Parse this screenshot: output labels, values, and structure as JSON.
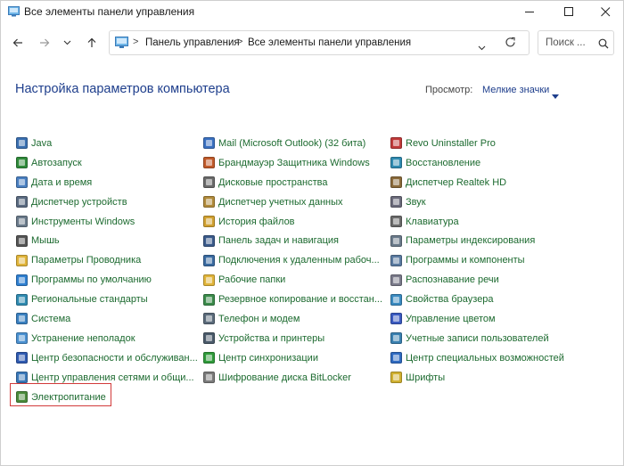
{
  "window": {
    "title": "Все элементы панели управления"
  },
  "address": {
    "crumbs": [
      "Панель управления",
      "Все элементы панели управления"
    ],
    "separator": ">"
  },
  "search": {
    "placeholder": "Поиск ..."
  },
  "header": {
    "title": "Настройка параметров компьютера",
    "view_label": "Просмотр:",
    "view_value": "Мелкие значки"
  },
  "items": {
    "col1": [
      {
        "label": "Java",
        "icon": "java-icon",
        "color": "#3a6fb0"
      },
      {
        "label": "Автозапуск",
        "icon": "autoplay-icon",
        "color": "#2f8a3a"
      },
      {
        "label": "Дата и время",
        "icon": "clock-icon",
        "color": "#4a7fc0"
      },
      {
        "label": "Диспетчер устройств",
        "icon": "device-manager-icon",
        "color": "#5a6a80"
      },
      {
        "label": "Инструменты Windows",
        "icon": "tools-icon",
        "color": "#6a7a8a"
      },
      {
        "label": "Мышь",
        "icon": "mouse-icon",
        "color": "#555555"
      },
      {
        "label": "Параметры Проводника",
        "icon": "folder-options-icon",
        "color": "#e0b43a"
      },
      {
        "label": "Программы по умолчанию",
        "icon": "default-programs-icon",
        "color": "#2f7fd0"
      },
      {
        "label": "Региональные стандарты",
        "icon": "region-icon",
        "color": "#2f8ab0"
      },
      {
        "label": "Система",
        "icon": "system-icon",
        "color": "#3a80c0"
      },
      {
        "label": "Устранение неполадок",
        "icon": "troubleshoot-icon",
        "color": "#4a90d0"
      },
      {
        "label": "Центр безопасности и обслуживан...",
        "icon": "security-flag-icon",
        "color": "#2f5ab0"
      },
      {
        "label": "Центр управления сетями и общи...",
        "icon": "network-icon",
        "color": "#3a78b8"
      },
      {
        "label": "Электропитание",
        "icon": "power-icon",
        "color": "#4a8a3a"
      }
    ],
    "col2": [
      {
        "label": "Mail (Microsoft Outlook) (32 бита)",
        "icon": "mail-icon",
        "color": "#3a70c0"
      },
      {
        "label": "Брандмауэр Защитника Windows",
        "icon": "firewall-icon",
        "color": "#c05a2a"
      },
      {
        "label": "Дисковые пространства",
        "icon": "storage-spaces-icon",
        "color": "#6a6a6a"
      },
      {
        "label": "Диспетчер учетных данных",
        "icon": "credentials-icon",
        "color": "#b08a3a"
      },
      {
        "label": "История файлов",
        "icon": "file-history-icon",
        "color": "#d0a030"
      },
      {
        "label": "Панель задач и навигация",
        "icon": "taskbar-icon",
        "color": "#3a5a8a"
      },
      {
        "label": "Подключения к удаленным рабоч...",
        "icon": "remote-desktop-icon",
        "color": "#3a6aa0"
      },
      {
        "label": "Рабочие папки",
        "icon": "work-folders-icon",
        "color": "#e0b43a"
      },
      {
        "label": "Резервное копирование и восстан...",
        "icon": "backup-icon",
        "color": "#3a8a4a"
      },
      {
        "label": "Телефон и модем",
        "icon": "phone-icon",
        "color": "#5a6a7a"
      },
      {
        "label": "Устройства и принтеры",
        "icon": "printer-icon",
        "color": "#4a5a6a"
      },
      {
        "label": "Центр синхронизации",
        "icon": "sync-icon",
        "color": "#2f9a3a"
      },
      {
        "label": "Шифрование диска BitLocker",
        "icon": "bitlocker-icon",
        "color": "#7a7a7a"
      }
    ],
    "col3": [
      {
        "label": "Revo Uninstaller Pro",
        "icon": "revo-icon",
        "color": "#c03a3a"
      },
      {
        "label": "Восстановление",
        "icon": "recovery-icon",
        "color": "#2f8ab0"
      },
      {
        "label": "Диспетчер Realtek HD",
        "icon": "realtek-icon",
        "color": "#8a6a3a"
      },
      {
        "label": "Звук",
        "icon": "sound-icon",
        "color": "#6a6a7a"
      },
      {
        "label": "Клавиатура",
        "icon": "keyboard-icon",
        "color": "#6a6a6a"
      },
      {
        "label": "Параметры индексирования",
        "icon": "indexing-icon",
        "color": "#6a7a8a"
      },
      {
        "label": "Программы и компоненты",
        "icon": "programs-icon",
        "color": "#5a7aa0"
      },
      {
        "label": "Распознавание речи",
        "icon": "speech-icon",
        "color": "#7a7a8a"
      },
      {
        "label": "Свойства браузера",
        "icon": "internet-options-icon",
        "color": "#3a8ac0"
      },
      {
        "label": "Управление цветом",
        "icon": "color-management-icon",
        "color": "#3a5ac0"
      },
      {
        "label": "Учетные записи пользователей",
        "icon": "user-accounts-icon",
        "color": "#3a80b0"
      },
      {
        "label": "Центр специальных возможностей",
        "icon": "accessibility-icon",
        "color": "#2f6ac0"
      },
      {
        "label": "Шрифты",
        "icon": "fonts-icon",
        "color": "#d0b030"
      }
    ]
  },
  "highlight": "Электропитание"
}
